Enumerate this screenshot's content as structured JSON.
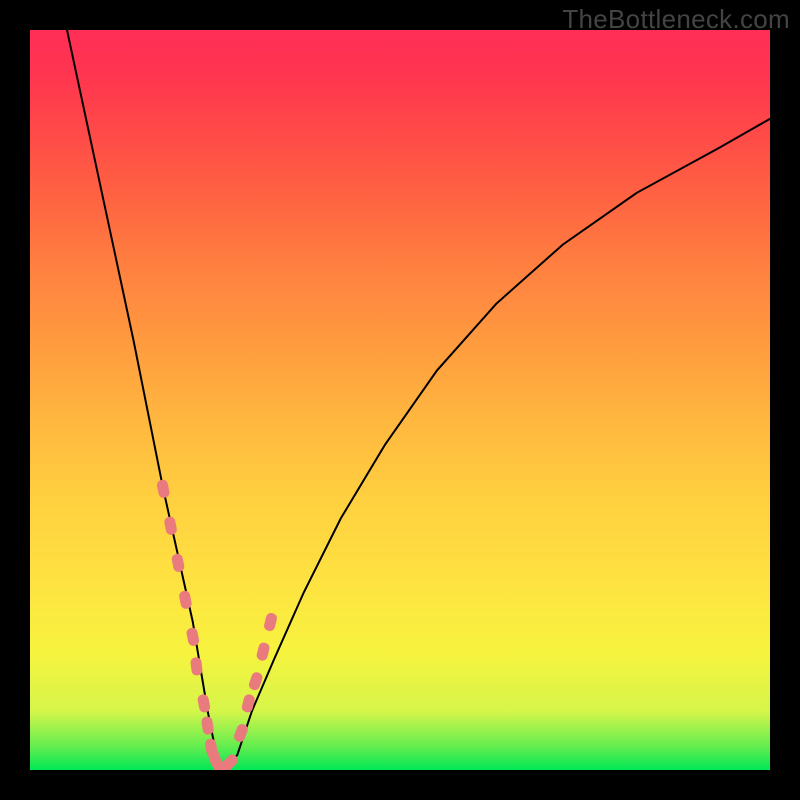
{
  "watermark": "TheBottleneck.com",
  "colors": {
    "background": "#000000",
    "gradient_top": "#ff2e57",
    "gradient_mid": "#ffcf3f",
    "gradient_bottom": "#00e756",
    "curve": "#000000",
    "markers": "#e97a7d"
  },
  "chart_data": {
    "type": "line",
    "title": "",
    "xlabel": "",
    "ylabel": "",
    "xlim": [
      0,
      100
    ],
    "ylim": [
      0,
      100
    ],
    "grid": false,
    "legend": false,
    "series": [
      {
        "name": "bottleneck-curve",
        "x": [
          5,
          8,
          11,
          14,
          16,
          18,
          20,
          22,
          23,
          24,
          25,
          26,
          28,
          30,
          33,
          37,
          42,
          48,
          55,
          63,
          72,
          82,
          93,
          100
        ],
        "y": [
          100,
          86,
          72,
          58,
          48,
          38,
          29,
          20,
          14,
          8,
          3,
          0,
          2,
          8,
          15,
          24,
          34,
          44,
          54,
          63,
          71,
          78,
          84,
          88
        ]
      }
    ],
    "markers": {
      "name": "highlight-points",
      "shape": "rounded",
      "color": "#e97a7d",
      "x": [
        18,
        19,
        20,
        21,
        22,
        22.5,
        23.5,
        24,
        24.5,
        25,
        25.5,
        26,
        27,
        28.5,
        29.5,
        30.5,
        31.5,
        32.5
      ],
      "y": [
        38,
        33,
        28,
        23,
        18,
        14,
        9,
        6,
        3,
        1.5,
        0.5,
        0,
        1,
        5,
        9,
        12,
        16,
        20
      ]
    },
    "annotations": [
      {
        "text": "TheBottleneck.com",
        "position": "top-right"
      }
    ]
  }
}
